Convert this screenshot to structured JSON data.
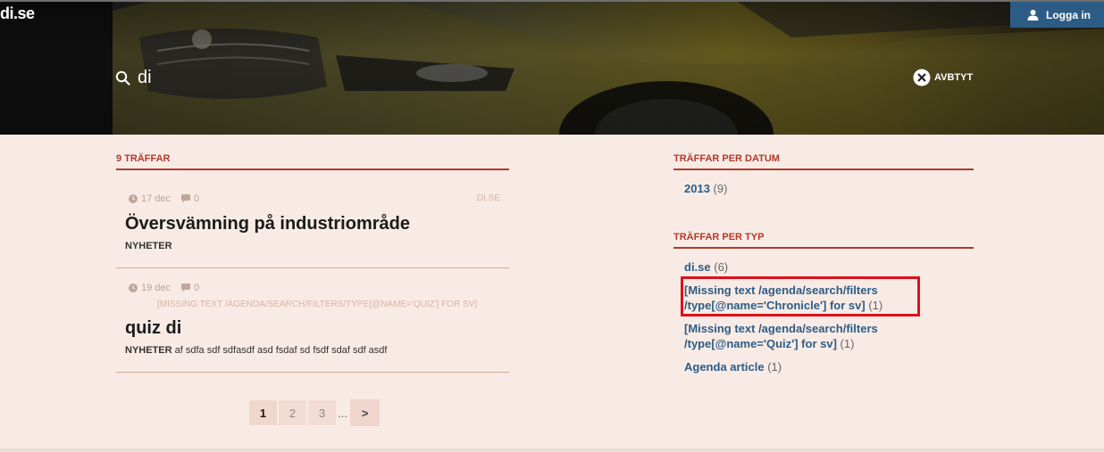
{
  "header": {
    "logo": "di.se",
    "login_label": "Logga in",
    "search_value": "di",
    "cancel_label": "AVBTYT"
  },
  "results": {
    "heading": "9 TRÄFFAR",
    "items": [
      {
        "date": "17 dec",
        "comments": "0",
        "source": "DI.SE",
        "title": "Översvämning på industriområde",
        "category": "NYHETER",
        "snippet": ""
      },
      {
        "date": "19 dec",
        "comments": "0",
        "source": "[MISSING TEXT /AGENDA/SEARCH/FILTERS/TYPE[@NAME='QUIZ'] FOR SV]",
        "title": "quiz di",
        "category": "NYHETER",
        "snippet": "af sdfa sdf sdfasdf asd fsdaf sd fsdf sdaf sdf asdf"
      }
    ]
  },
  "pagination": {
    "pages": [
      "1",
      "2",
      "3"
    ],
    "ellipsis": "...",
    "next": ">"
  },
  "sidebar": {
    "by_date": {
      "heading": "TRÄFFAR PER DATUM",
      "items": [
        {
          "label": "2013",
          "count": "(9)"
        }
      ]
    },
    "by_type": {
      "heading": "TRÄFFAR PER TYP",
      "items": [
        {
          "label": "di.se",
          "count": "(6)"
        },
        {
          "label_line1": "[Missing text /agenda/search/filters",
          "label_line2": "/type[@name='Chronicle'] for sv]",
          "count": "(1)"
        },
        {
          "label_line1": "[Missing text /agenda/search/filters",
          "label_line2": "/type[@name='Quiz'] for sv]",
          "count": "(1)"
        },
        {
          "label": "Agenda article",
          "count": "(1)"
        }
      ]
    }
  },
  "colors": {
    "accent": "#b23a2a",
    "link": "#2c5c86",
    "background": "#f8ebe5",
    "highlight": "#e0101a"
  }
}
